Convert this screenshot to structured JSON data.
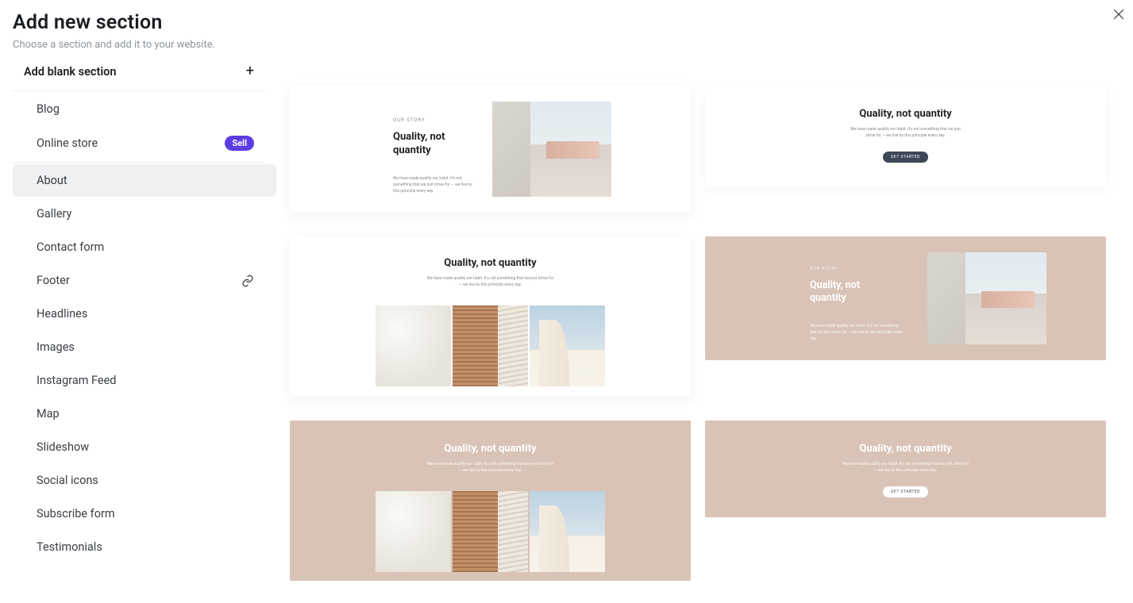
{
  "header": {
    "title": "Add new section",
    "subtitle": "Choose a section and add it to your website."
  },
  "sidebar": {
    "addBlank": "Add blank section",
    "items": [
      {
        "label": "Blog"
      },
      {
        "label": "Online store",
        "badge": "Sell"
      },
      {
        "label": "About",
        "active": true
      },
      {
        "label": "Gallery"
      },
      {
        "label": "Contact form"
      },
      {
        "label": "Footer",
        "linkIcon": true
      },
      {
        "label": "Headlines"
      },
      {
        "label": "Images"
      },
      {
        "label": "Instagram Feed"
      },
      {
        "label": "Map"
      },
      {
        "label": "Slideshow"
      },
      {
        "label": "Social icons"
      },
      {
        "label": "Subscribe form"
      },
      {
        "label": "Testimonials"
      }
    ]
  },
  "templates": {
    "eyebrow": "OUR STORY",
    "title": "Quality, not quantity",
    "body": "We have made quality our habit. It's not something that we just strive for — we live by this principle every day.",
    "buttonLabel": "GET STARTED"
  },
  "colors": {
    "beige": "#d9c3b6",
    "darkButton": "#3d4756",
    "badge": "#5b3de3"
  }
}
